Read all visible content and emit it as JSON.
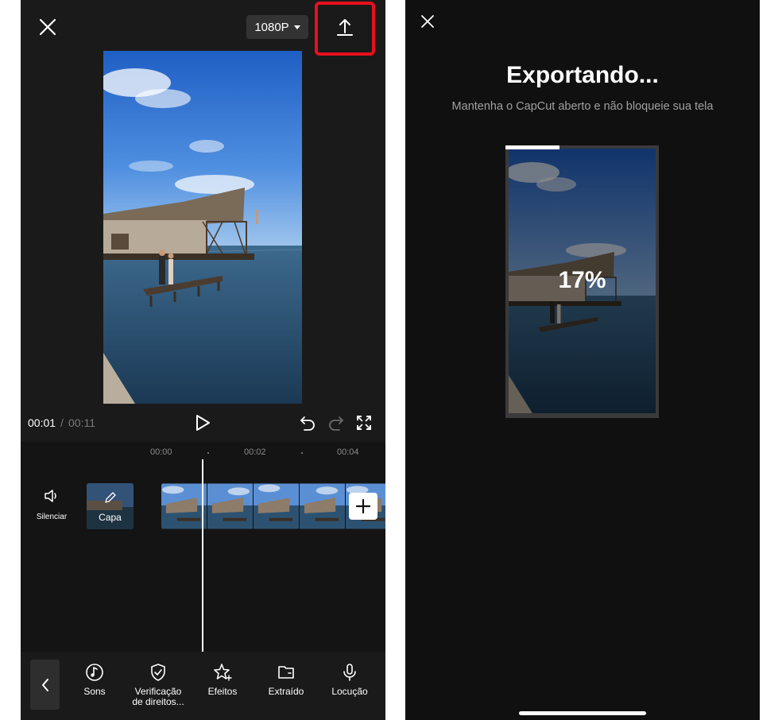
{
  "editor": {
    "resolution": "1080P",
    "time_current": "00:01",
    "time_separator": "/",
    "time_total": "00:11",
    "ruler": [
      "00:00",
      "00:02",
      "00:04"
    ],
    "mute_label": "Silenciar",
    "cover_label": "Capa",
    "tools": [
      {
        "label": "Sons",
        "icon": "music-note-icon"
      },
      {
        "label": "Verificação\nde direitos...",
        "icon": "shield-check-icon"
      },
      {
        "label": "Efeitos",
        "icon": "sparkle-star-icon"
      },
      {
        "label": "Extraído",
        "icon": "folder-icon"
      },
      {
        "label": "Locução",
        "icon": "microphone-icon"
      }
    ],
    "highlight_color": "#e8101e"
  },
  "export": {
    "title": "Exportando...",
    "subtitle": "Mantenha o CapCut aberto e não bloqueie sua tela",
    "progress_percent_label": "17%",
    "progress_fraction": 0.35
  }
}
